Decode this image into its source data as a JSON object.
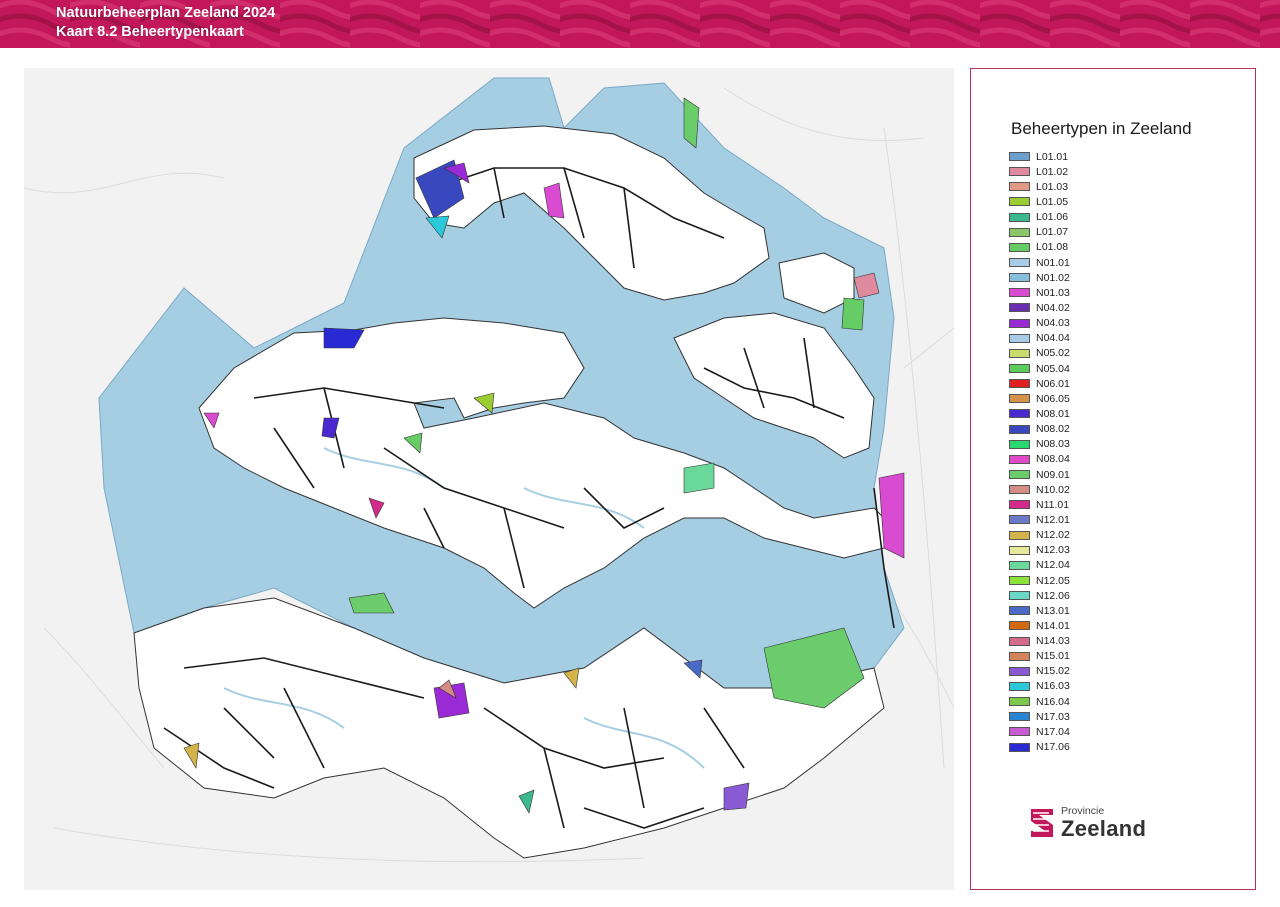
{
  "header": {
    "title": "Natuurbeheerplan Zeeland 2024",
    "subtitle": "Kaart 8.2 Beheertypenkaart",
    "color": "#c2185b"
  },
  "map": {
    "water_color": "#a6cee3",
    "land_color": "#ffffff",
    "background_color": "#f2f2f2"
  },
  "legend": {
    "title": "Beheertypen in Zeeland",
    "items": [
      {
        "label": "L01.01",
        "color": "#6a9fd0"
      },
      {
        "label": "L01.02",
        "color": "#e08aa0"
      },
      {
        "label": "L01.03",
        "color": "#e09a84"
      },
      {
        "label": "L01.05",
        "color": "#9acd32"
      },
      {
        "label": "L01.06",
        "color": "#3cb98c"
      },
      {
        "label": "L01.07",
        "color": "#8cc66a"
      },
      {
        "label": "L01.08",
        "color": "#66cc66"
      },
      {
        "label": "N01.01",
        "color": "#a8cce8"
      },
      {
        "label": "N01.02",
        "color": "#86c0dc"
      },
      {
        "label": "N01.03",
        "color": "#d94bd0"
      },
      {
        "label": "N04.02",
        "color": "#6a2fb0"
      },
      {
        "label": "N04.03",
        "color": "#9a2ad6"
      },
      {
        "label": "N04.04",
        "color": "#a8cce8"
      },
      {
        "label": "N05.02",
        "color": "#c8dc6e"
      },
      {
        "label": "N05.04",
        "color": "#5ccc5c"
      },
      {
        "label": "N06.01",
        "color": "#e02020"
      },
      {
        "label": "N06.05",
        "color": "#d4924a"
      },
      {
        "label": "N08.01",
        "color": "#4a2ad0"
      },
      {
        "label": "N08.02",
        "color": "#3a48c0"
      },
      {
        "label": "N08.03",
        "color": "#2ad870"
      },
      {
        "label": "N08.04",
        "color": "#e04ac8"
      },
      {
        "label": "N09.01",
        "color": "#6acc6a"
      },
      {
        "label": "N10.02",
        "color": "#d48c84"
      },
      {
        "label": "N11.01",
        "color": "#d42a8c"
      },
      {
        "label": "N12.01",
        "color": "#6a7ac8"
      },
      {
        "label": "N12.02",
        "color": "#d4b44a"
      },
      {
        "label": "N12.03",
        "color": "#e8e89a"
      },
      {
        "label": "N12.04",
        "color": "#6ad89a"
      },
      {
        "label": "N12.05",
        "color": "#8ae23a"
      },
      {
        "label": "N12.06",
        "color": "#6ad8c8"
      },
      {
        "label": "N13.01",
        "color": "#4a6ac8"
      },
      {
        "label": "N14.01",
        "color": "#d46a10"
      },
      {
        "label": "N14.03",
        "color": "#d46a8a"
      },
      {
        "label": "N15.01",
        "color": "#d4845a"
      },
      {
        "label": "N15.02",
        "color": "#8a5ad4"
      },
      {
        "label": "N16.03",
        "color": "#2ac8d8"
      },
      {
        "label": "N16.04",
        "color": "#7cc84a"
      },
      {
        "label": "N17.03",
        "color": "#2a84d4"
      },
      {
        "label": "N17.04",
        "color": "#c85ad4"
      },
      {
        "label": "N17.06",
        "color": "#2a2ad4"
      }
    ]
  },
  "logo": {
    "line1": "Provincie",
    "line2": "Zeeland",
    "color": "#c2185b"
  }
}
